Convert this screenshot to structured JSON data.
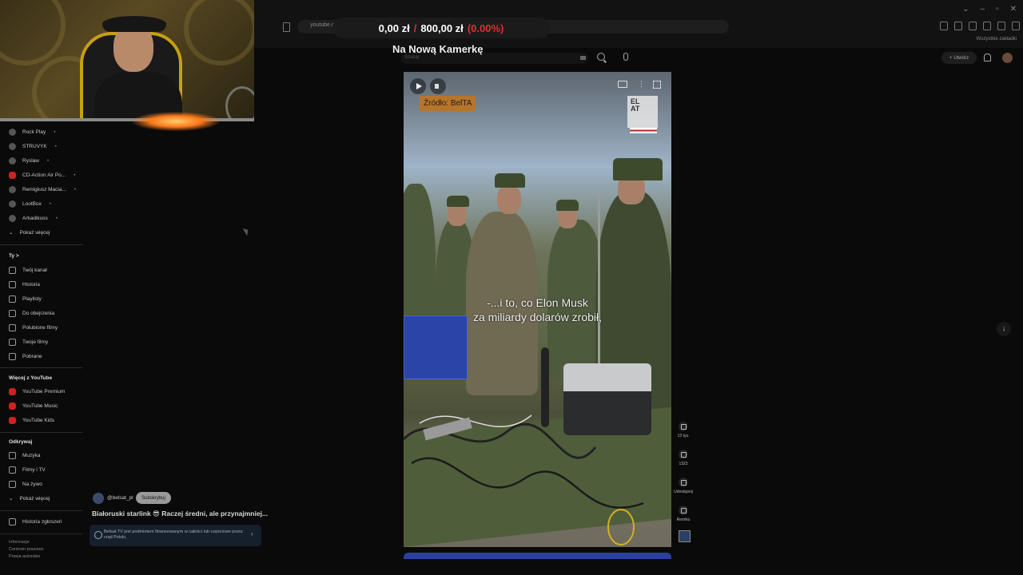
{
  "browser": {
    "url": "youtube.com/shorts/O0",
    "bookmarks_label": "Wszystkie zakładki",
    "window_controls": [
      "⌄",
      "–",
      "▫",
      "✕"
    ]
  },
  "overlay": {
    "donation": {
      "current": "0,00 zł",
      "separator": "/",
      "goal": "800,00 zł",
      "percent": "(0.00%)"
    },
    "stream_title": "Na Nową Kamerkę"
  },
  "header": {
    "search_placeholder": "Szukaj",
    "create_label": "Utwórz"
  },
  "sidebar": {
    "subscriptions": [
      {
        "label": "Rock Play",
        "chevron": "•"
      },
      {
        "label": "STRUVYK",
        "chevron": "•"
      },
      {
        "label": "Ryslaw",
        "chevron": "•"
      },
      {
        "label": "CD-Action Air Po...",
        "chevron": "•"
      },
      {
        "label": "Remigiusz Macia...",
        "chevron": "•"
      },
      {
        "label": "LootBox",
        "chevron": "•"
      },
      {
        "label": "Arkadikuss",
        "chevron": "•"
      }
    ],
    "show_more": "Pokaż więcej",
    "you_heading": "Ty",
    "you_chevron": ">",
    "you_items": [
      "Twój kanał",
      "Historia",
      "Playlisty",
      "Do obejrzenia",
      "Polubione filmy",
      "Twoje filmy",
      "Pobrane"
    ],
    "more_heading": "Więcej z YouTube",
    "more_items": [
      "YouTube Premium",
      "YouTube Music",
      "YouTube Kids"
    ],
    "explore_heading": "Odkrywaj",
    "explore_items": [
      "Muzyka",
      "Filmy i TV",
      "Na żywo"
    ],
    "explore_more": "Pokaż więcej",
    "report_history": "Historia zgłoszeń",
    "footer": [
      "Informacje",
      "Centrum prasowe",
      "Prawa autorskie"
    ]
  },
  "video": {
    "source_badge": "Źródło: BelTA",
    "logo_text": [
      "EL",
      "AT"
    ],
    "subtitle_lines": [
      "-...i to, co Elon Musk",
      "za miliardy dolarów zrobił,"
    ],
    "more_glyph": "⋮"
  },
  "actions": [
    {
      "name": "like",
      "label": "13 tys."
    },
    {
      "name": "comments",
      "label": "1322"
    },
    {
      "name": "share",
      "label": "Udostępnij"
    },
    {
      "name": "remix",
      "label": "Remiks"
    }
  ],
  "scroll_glyph": "↓",
  "channel": {
    "handle": "@belsat_pl",
    "subscribe_label": "Subskrybuj",
    "video_title": "Białoruski starlink 😎 Raczej średni, ale przynajmniej...",
    "info_text": "Belsat TV jest podmiotem finansowanym w całości lub częściowo przez rząd Polski.",
    "info_chevron": "›"
  }
}
